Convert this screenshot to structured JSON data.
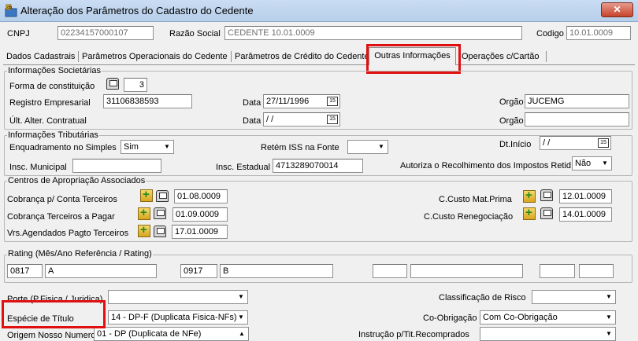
{
  "window": {
    "title": "Alteração dos Parâmetros do Cadastro do Cedente",
    "close_label": "✕"
  },
  "header": {
    "cnpj_label": "CNPJ",
    "cnpj_value": "02234157000107",
    "razao_label": "Razão Social",
    "razao_value": "CEDENTE 10.01.0009",
    "codigo_label": "Codigo",
    "codigo_value": "10.01.0009"
  },
  "tabs": [
    {
      "label": "Dados Cadastrais"
    },
    {
      "label": "Parâmetros Operacionais do Cedente"
    },
    {
      "label": "Parâmetros de Crédito do Cedente"
    },
    {
      "label": "Outras Informações"
    },
    {
      "label": "Operações c/Cartão"
    }
  ],
  "societarias": {
    "title": "Informações Societárias",
    "forma_label": "Forma de constituição",
    "forma_value": "3",
    "registro_label": "Registro Empresarial",
    "registro_value": "31106838593",
    "data_label": "Data",
    "data_value": "27/11/1996",
    "orgao_label": "Orgão",
    "orgao_value": "JUCEMG",
    "ult_label": "Últ. Alter. Contratual",
    "data2_label": "Data",
    "data2_value": " /  /",
    "orgao2_label": "Orgão",
    "orgao2_value": ""
  },
  "tributarias": {
    "title": "Informações Tributárias",
    "simples_label": "Enquadramento no Simples",
    "simples_value": "Sim",
    "iss_label": "Retém ISS na Fonte",
    "iss_value": "",
    "dtinicio_label": "Dt.Início",
    "dtinicio_value": " /  /",
    "municipal_label": "Insc. Municipal",
    "municipal_value": "",
    "estadual_label": "Insc. Estadual",
    "estadual_value": "4713289070014",
    "autoriza_label": "Autoriza o Recolhimento  dos Impostos Retid",
    "autoriza_value": "Não"
  },
  "centros": {
    "title": "Centros de Apropriação Associados",
    "cobranca_label": "Cobrança p/ Conta Terceiros",
    "cobranca_value": "01.08.0009",
    "terceiros_label": "Cobrança Terceiros a Pagar",
    "terceiros_value": "01.09.0009",
    "vrs_label": "Vrs.Agendados Pagto Terceiros",
    "vrs_value": "17.01.0009",
    "materia_label": "C.Custo Mat.Prima",
    "materia_value": "12.01.0009",
    "reneg_label": "C.Custo Renegociação",
    "reneg_value": "14.01.0009"
  },
  "rating": {
    "title": "Rating (Mês/Ano Referência / Rating)",
    "r1_month": "0817",
    "r1_value": "A",
    "r2_month": "0917",
    "r2_value": "B"
  },
  "bottom": {
    "porte_label": "Porte (P.Fisica / Juridica)",
    "porte_value": "",
    "classificacao_label": "Classificação de Risco",
    "classificacao_value": "",
    "especie_label": "Espécie de Título",
    "especie_value": "14 - DP-F (Duplicata Fisica-NFs)",
    "coobrigacao_label": "Co-Obrigação",
    "coobrigacao_value": "Com Co-Obrigação",
    "origem_label": "Origem Nosso Numero",
    "origem_value": "01 - DP (Duplicata de NFe)",
    "instrucao_label": "Instrução p/Tit.Recomprados",
    "instrucao_value": ""
  },
  "colors": {
    "highlight": "#e01010",
    "titlebar": "#c9dcf2",
    "panel": "#f0f0f0"
  }
}
